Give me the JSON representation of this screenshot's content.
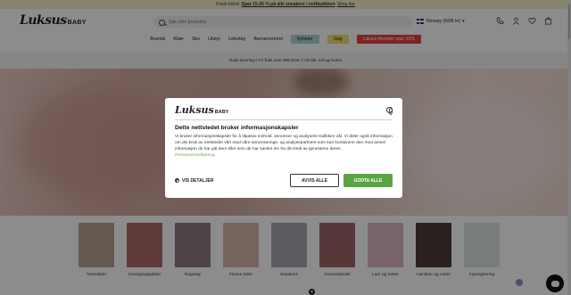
{
  "promo": {
    "lead": "Fresh kicks!",
    "bold": "Spar 15-20 % på alle sneakers i nettbutikken",
    "link": "Shop her"
  },
  "header": {
    "logo_script": "Luksus",
    "logo_baby": "BABY",
    "search_placeholder": "Søk etter produkter",
    "locale": "Norway (NOK kr)",
    "icons": [
      "phone-icon",
      "user-icon",
      "heart-icon",
      "bag-icon"
    ]
  },
  "nav": {
    "items": [
      "Brands",
      "Klær",
      "Sko",
      "Utstyr",
      "Leketøy",
      "Barnerommet"
    ],
    "nyheter": "Nyheter",
    "salg": "Salg",
    "member": "Luksus Member spar 10%"
  },
  "shipping": "Rask levering // Fri frakt over 999 NOK // Alt inkl. toll og moms",
  "categories": [
    {
      "label": "Termoklær",
      "color": "#b9a594"
    },
    {
      "label": "Overgangsjakker",
      "color": "#b06a68"
    },
    {
      "label": "Regntøy",
      "color": "#8e7c80"
    },
    {
      "label": "Fleece Klær",
      "color": "#d9b5ac"
    },
    {
      "label": "Sneakers",
      "color": "#a7a6b3"
    },
    {
      "label": "Gummistøvler",
      "color": "#a06468"
    },
    {
      "label": "Luer og Votter",
      "color": "#dcb7c4"
    },
    {
      "label": "Hansker og votter",
      "color": "#4d3d3a"
    },
    {
      "label": "Impregnering",
      "color": "#d8e4df"
    }
  ],
  "modal": {
    "logo_script": "Luksus",
    "logo_baby": "BABY",
    "title": "Dette nettstedet bruker informasjonskapsler",
    "body": "Vi bruker informasjonskapsler for å tilpasse innhold, annonser og analysere trafikken vår. Vi deler også informasjon om din bruk av nettstedet vårt med våre annonserings- og analysepartnere som kan kombinere den med annen informasjon du har gitt dem eller som de har samlet inn fra din bruk av tjenestene deres.",
    "link": "Personvernerklæring",
    "details": "VIS DETALJER",
    "reject": "AVVIS ALLE",
    "accept": "GODTA ALLE"
  },
  "close_glyph": "×"
}
